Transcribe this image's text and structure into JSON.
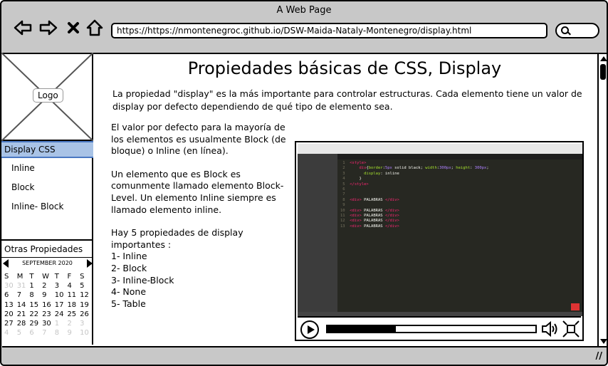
{
  "window": {
    "title": "A Web Page",
    "url": "https://https://nmontenegroc.github.io/DSW-Maida-Nataly-Montenegro/display.html"
  },
  "sidebar": {
    "logo_label": "Logo",
    "active_item": "Display CSS",
    "items": [
      {
        "label": "Inline"
      },
      {
        "label": "Block"
      },
      {
        "label": "Inline- Block"
      }
    ],
    "other_label": "Otras Propiedades"
  },
  "calendar": {
    "month_label": "SEPTEMBER 2020",
    "weekdays": [
      "S",
      "M",
      "T",
      "W",
      "T",
      "F",
      "S"
    ],
    "days": [
      {
        "d": "30",
        "dim": true
      },
      {
        "d": "31",
        "dim": true
      },
      {
        "d": "1"
      },
      {
        "d": "2"
      },
      {
        "d": "3"
      },
      {
        "d": "4"
      },
      {
        "d": "5"
      },
      {
        "d": "6"
      },
      {
        "d": "7"
      },
      {
        "d": "8"
      },
      {
        "d": "9"
      },
      {
        "d": "10"
      },
      {
        "d": "11"
      },
      {
        "d": "12"
      },
      {
        "d": "13"
      },
      {
        "d": "14"
      },
      {
        "d": "15"
      },
      {
        "d": "16",
        "today": true
      },
      {
        "d": "17"
      },
      {
        "d": "18"
      },
      {
        "d": "19"
      },
      {
        "d": "20"
      },
      {
        "d": "21"
      },
      {
        "d": "22"
      },
      {
        "d": "23"
      },
      {
        "d": "24"
      },
      {
        "d": "25"
      },
      {
        "d": "26"
      },
      {
        "d": "27"
      },
      {
        "d": "28"
      },
      {
        "d": "29"
      },
      {
        "d": "30"
      },
      {
        "d": "1",
        "dim": true
      },
      {
        "d": "2",
        "dim": true
      },
      {
        "d": "3",
        "dim": true
      },
      {
        "d": "4",
        "dim": true
      },
      {
        "d": "5",
        "dim": true
      },
      {
        "d": "6",
        "dim": true
      },
      {
        "d": "7",
        "dim": true
      },
      {
        "d": "8",
        "dim": true
      },
      {
        "d": "9",
        "dim": true
      },
      {
        "d": "10",
        "dim": true
      }
    ]
  },
  "main": {
    "title": "Propiedades básicas de CSS, Display",
    "intro": "La propiedad \"display\"  es la más importante para controlar estructuras. Cada elemento tiene un valor de display por defecto dependiendo de qué tipo de elemento sea.",
    "paragraph1": "El valor por defecto para la mayoría de los elementos es usualmente Block (de bloque) o Inline (en línea).",
    "paragraph2": "Un elemento que es Block es comunmente llamado elemento Block-Level. Un elemento Inline siempre es llamado elemento inline.",
    "list_intro": "Hay 5 propiedades de display importantes :",
    "list": [
      "1-  Inline",
      "2- Block",
      "3- Inline-Block",
      "4- None",
      "5- Table"
    ]
  },
  "video": {
    "progress": 0.33,
    "code_lines": [
      {
        "n": "1",
        "html": "<span class='tag'>&lt;style&gt;</span>"
      },
      {
        "n": "2",
        "html": "    <span class='tag'>div</span>{<span class='attr'>border</span>:<span class='num'>5px</span> solid black; <span class='attr'>width</span>:<span class='num'>300px</span>; <span class='attr'>height</span>: <span class='num'>300px</span>;"
      },
      {
        "n": "3",
        "html": "      <span class='attr'>display</span>: inline"
      },
      {
        "n": "4",
        "html": "    }"
      },
      {
        "n": "5",
        "html": "<span class='tag'>&lt;/style&gt;</span>"
      },
      {
        "n": "6",
        "html": ""
      },
      {
        "n": "7",
        "html": ""
      },
      {
        "n": "8",
        "html": "<span class='tag'>&lt;div&gt;</span> PALABRAS <span class='tag'>&lt;/div&gt;</span>"
      },
      {
        "n": "9",
        "html": ""
      },
      {
        "n": "10",
        "html": "<span class='tag'>&lt;div&gt;</span> PALABRAS <span class='tag'>&lt;/div&gt;</span>"
      },
      {
        "n": "11",
        "html": "<span class='tag'>&lt;div&gt;</span> PALABRAS <span class='tag'>&lt;/div&gt;</span>"
      },
      {
        "n": "12",
        "html": "<span class='tag'>&lt;div&gt;</span> PALABRAS <span class='tag'>&lt;/div&gt;</span>"
      },
      {
        "n": "13",
        "html": "<span class='tag'>&lt;div&gt;</span> PALABRAS <span class='tag'>&lt;/div&gt;</span>"
      }
    ]
  }
}
